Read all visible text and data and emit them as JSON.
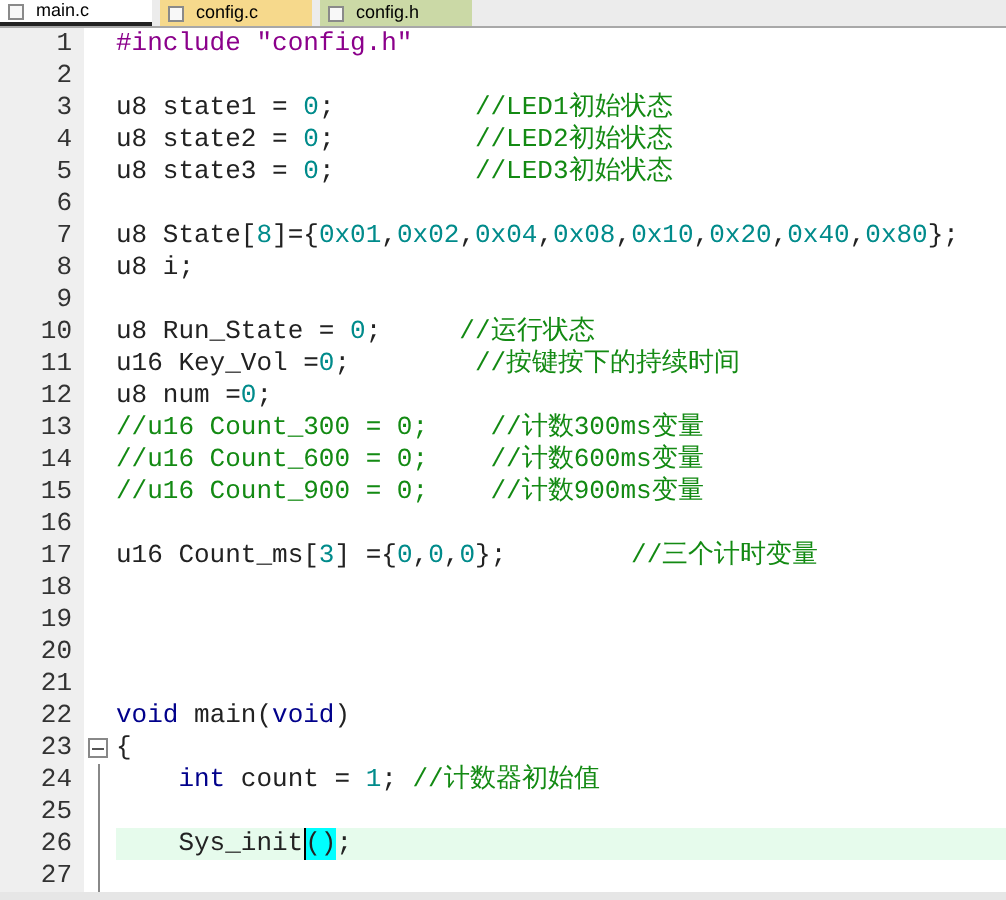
{
  "tabs": [
    {
      "label": "main.c",
      "selected": true,
      "color": "#ffffff"
    },
    {
      "label": "config.c",
      "selected": false,
      "color": "#f6d98c"
    },
    {
      "label": "config.h",
      "selected": false,
      "color": "#cbd9a6"
    }
  ],
  "lines": [
    {
      "number": "1",
      "kind": "plain",
      "current": false,
      "segments": [
        {
          "kind": "preproc",
          "text": "#include "
        },
        {
          "kind": "string",
          "text": "\"config.h\""
        }
      ]
    },
    {
      "number": "2",
      "kind": "plain",
      "current": false
    },
    {
      "number": "3",
      "kind": "plain",
      "current": false,
      "segments": [
        {
          "kind": "text",
          "text": "u8 state1 = "
        },
        {
          "kind": "number",
          "text": "0"
        },
        {
          "kind": "text",
          "text": ";         "
        },
        {
          "kind": "comment",
          "text": "//LED1初始状态"
        }
      ]
    },
    {
      "number": "4",
      "kind": "plain",
      "current": false,
      "segments": [
        {
          "kind": "text",
          "text": "u8 state2 = "
        },
        {
          "kind": "number",
          "text": "0"
        },
        {
          "kind": "text",
          "text": ";         "
        },
        {
          "kind": "comment",
          "text": "//LED2初始状态"
        }
      ]
    },
    {
      "number": "5",
      "kind": "plain",
      "current": false,
      "segments": [
        {
          "kind": "text",
          "text": "u8 state3 = "
        },
        {
          "kind": "number",
          "text": "0"
        },
        {
          "kind": "text",
          "text": ";         "
        },
        {
          "kind": "comment",
          "text": "//LED3初始状态"
        }
      ]
    },
    {
      "number": "6",
      "kind": "plain",
      "current": false
    },
    {
      "number": "7",
      "kind": "plain",
      "current": false,
      "segments": [
        {
          "kind": "text",
          "text": "u8 State["
        },
        {
          "kind": "number",
          "text": "8"
        },
        {
          "kind": "text",
          "text": "]={"
        },
        {
          "kind": "number",
          "text": "0x01"
        },
        {
          "kind": "text",
          "text": ","
        },
        {
          "kind": "number",
          "text": "0x02"
        },
        {
          "kind": "text",
          "text": ","
        },
        {
          "kind": "number",
          "text": "0x04"
        },
        {
          "kind": "text",
          "text": ","
        },
        {
          "kind": "number",
          "text": "0x08"
        },
        {
          "kind": "text",
          "text": ","
        },
        {
          "kind": "number",
          "text": "0x10"
        },
        {
          "kind": "text",
          "text": ","
        },
        {
          "kind": "number",
          "text": "0x20"
        },
        {
          "kind": "text",
          "text": ","
        },
        {
          "kind": "number",
          "text": "0x40"
        },
        {
          "kind": "text",
          "text": ","
        },
        {
          "kind": "number",
          "text": "0x80"
        },
        {
          "kind": "text",
          "text": "};"
        }
      ]
    },
    {
      "number": "8",
      "kind": "plain",
      "current": false,
      "segments": [
        {
          "kind": "text",
          "text": "u8 i;"
        }
      ]
    },
    {
      "number": "9",
      "kind": "plain",
      "current": false
    },
    {
      "number": "10",
      "kind": "plain",
      "current": false,
      "segments": [
        {
          "kind": "text",
          "text": "u8 Run_State = "
        },
        {
          "kind": "number",
          "text": "0"
        },
        {
          "kind": "text",
          "text": ";     "
        },
        {
          "kind": "comment",
          "text": "//运行状态"
        }
      ]
    },
    {
      "number": "11",
      "kind": "plain",
      "current": false,
      "segments": [
        {
          "kind": "text",
          "text": "u16 Key_Vol ="
        },
        {
          "kind": "number",
          "text": "0"
        },
        {
          "kind": "text",
          "text": ";        "
        },
        {
          "kind": "comment",
          "text": "//按键按下的持续时间"
        }
      ]
    },
    {
      "number": "12",
      "kind": "plain",
      "current": false,
      "segments": [
        {
          "kind": "text",
          "text": "u8 num ="
        },
        {
          "kind": "number",
          "text": "0"
        },
        {
          "kind": "text",
          "text": ";"
        }
      ]
    },
    {
      "number": "13",
      "kind": "plain",
      "current": false,
      "segments": [
        {
          "kind": "comment",
          "text": "//u16 Count_300 = 0;    //计数300ms变量"
        }
      ]
    },
    {
      "number": "14",
      "kind": "plain",
      "current": false,
      "segments": [
        {
          "kind": "comment",
          "text": "//u16 Count_600 = 0;    //计数600ms变量"
        }
      ]
    },
    {
      "number": "15",
      "kind": "plain",
      "current": false,
      "segments": [
        {
          "kind": "comment",
          "text": "//u16 Count_900 = 0;    //计数900ms变量"
        }
      ]
    },
    {
      "number": "16",
      "kind": "plain",
      "current": false
    },
    {
      "number": "17",
      "kind": "plain",
      "current": false,
      "segments": [
        {
          "kind": "text",
          "text": "u16 Count_ms["
        },
        {
          "kind": "number",
          "text": "3"
        },
        {
          "kind": "text",
          "text": "] ={"
        },
        {
          "kind": "number",
          "text": "0"
        },
        {
          "kind": "text",
          "text": ","
        },
        {
          "kind": "number",
          "text": "0"
        },
        {
          "kind": "text",
          "text": ","
        },
        {
          "kind": "number",
          "text": "0"
        },
        {
          "kind": "text",
          "text": "};        "
        },
        {
          "kind": "comment",
          "text": "//三个计时变量"
        }
      ]
    },
    {
      "number": "18",
      "kind": "plain",
      "current": false
    },
    {
      "number": "19",
      "kind": "plain",
      "current": false
    },
    {
      "number": "20",
      "kind": "plain",
      "current": false
    },
    {
      "number": "21",
      "kind": "plain",
      "current": false
    },
    {
      "number": "22",
      "kind": "plain",
      "current": false,
      "segments": [
        {
          "kind": "keyword",
          "text": "void"
        },
        {
          "kind": "text",
          "text": " main("
        },
        {
          "kind": "keyword",
          "text": "void"
        },
        {
          "kind": "text",
          "text": ")"
        }
      ]
    },
    {
      "number": "23",
      "kind": "fold_start",
      "expanded": true,
      "current": false,
      "segments": [
        {
          "kind": "text",
          "text": "{"
        }
      ]
    },
    {
      "number": "24",
      "kind": "fold_body",
      "indented": true,
      "current": false,
      "segments": [
        {
          "kind": "keyword",
          "text": "int"
        },
        {
          "kind": "text",
          "text": " count = "
        },
        {
          "kind": "number",
          "text": "1"
        },
        {
          "kind": "text",
          "text": "; "
        },
        {
          "kind": "comment",
          "text": "//计数器初始值"
        }
      ]
    },
    {
      "number": "25",
      "kind": "fold_body",
      "current": false
    },
    {
      "number": "26",
      "kind": "fold_body",
      "indented": true,
      "current": true,
      "segments": [
        {
          "kind": "text",
          "text": "Sys_init"
        },
        {
          "kind": "brace_match",
          "text": "()"
        },
        {
          "kind": "text",
          "text": ";"
        }
      ]
    },
    {
      "number": "27",
      "kind": "fold_body",
      "current": false
    }
  ]
}
